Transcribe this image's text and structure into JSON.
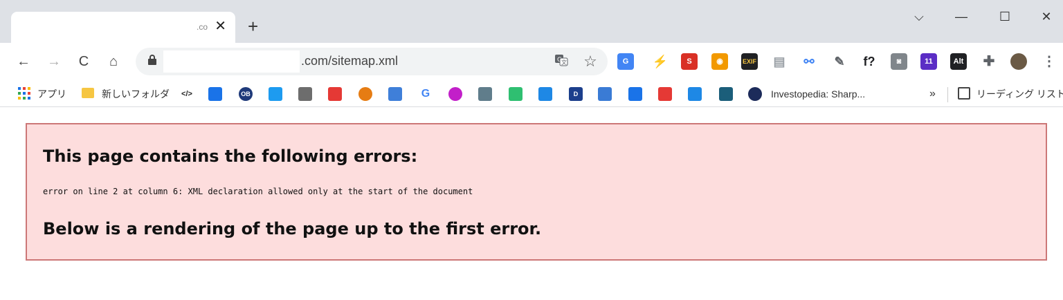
{
  "tab": {
    "title": ".co",
    "close_glyph": "✕"
  },
  "newtab_glyph": "+",
  "window_controls": {
    "tabsearch": "⌵",
    "minimize": "—",
    "maximize": "☐",
    "close": "✕"
  },
  "nav": {
    "back": "←",
    "forward": "→",
    "reload": "C",
    "home": "⌂"
  },
  "address": {
    "url_visible": ".com/sitemap.xml"
  },
  "omnibox_icons": {
    "translate": "translate-icon",
    "star": "☆"
  },
  "extensions": [
    {
      "name": "google-translate-ext-icon",
      "label": "G",
      "color": "#4285f4"
    },
    {
      "name": "bolt-ext-icon",
      "label": "⚡",
      "color": "#9aa0a6"
    },
    {
      "name": "seo-ext-icon",
      "label": "S",
      "color": "#d93025"
    },
    {
      "name": "orange-ext-icon",
      "label": "◉",
      "color": "#f29900"
    },
    {
      "name": "exif-ext-icon",
      "label": "EXIF",
      "color": "#202124"
    },
    {
      "name": "notes-ext-icon",
      "label": "▤",
      "color": "#9aa0a6"
    },
    {
      "name": "link-ext-icon",
      "label": "⚯",
      "color": "#4285f4"
    },
    {
      "name": "eyedropper-ext-icon",
      "label": "✎",
      "color": "#5f6368"
    },
    {
      "name": "font-ext-icon",
      "label": "f?",
      "color": "#202124"
    },
    {
      "name": "camera-ext-icon",
      "label": "◙",
      "color": "#80868b"
    },
    {
      "name": "grad-cap-ext-icon",
      "label": "11",
      "color": "#5b2dc5"
    },
    {
      "name": "alt-ext-icon",
      "label": "Alt",
      "color": "#202124"
    },
    {
      "name": "puzzle-icon",
      "label": "✚",
      "color": "#5f6368"
    },
    {
      "name": "profile-avatar",
      "label": "",
      "color": "#6b5a45"
    },
    {
      "name": "menu-icon",
      "label": "⋮",
      "color": "#5f6368"
    }
  ],
  "bookmarks": {
    "apps_label": "アプリ",
    "folder_label": "新しいフォルダ",
    "investopedia_label": "Investopedia: Sharp...",
    "overflow": "»",
    "reading_list_label": "リーディング リスト",
    "icons": [
      {
        "name": "code-bookmark-icon",
        "color": "#222222",
        "label": "</>"
      },
      {
        "name": "chart-bookmark-icon",
        "color": "#1a73e8",
        "label": ""
      },
      {
        "name": "ob-bookmark-icon",
        "color": "#1f3a7a",
        "label": "OB"
      },
      {
        "name": "twitter-bookmark-icon",
        "color": "#1d9bf0",
        "label": ""
      },
      {
        "name": "landscape-bookmark-icon",
        "color": "#6d6d6d",
        "label": ""
      },
      {
        "name": "flower-bookmark-icon",
        "color": "#e53935",
        "label": ""
      },
      {
        "name": "coin-bookmark-icon",
        "color": "#e67c13",
        "label": ""
      },
      {
        "name": "pixel-bookmark-icon",
        "color": "#3f7fd9",
        "label": ""
      },
      {
        "name": "google-bookmark-icon",
        "color": "#ffffff",
        "label": "G"
      },
      {
        "name": "purple-circle-bookmark-icon",
        "color": "#c21fc9",
        "label": ""
      },
      {
        "name": "robot-bookmark-icon",
        "color": "#607d8b",
        "label": ""
      },
      {
        "name": "bird-bookmark-icon",
        "color": "#2fbf71",
        "label": ""
      },
      {
        "name": "network-bookmark-icon",
        "color": "#1e88e5",
        "label": ""
      },
      {
        "name": "d-bookmark-icon",
        "color": "#1c3f8c",
        "label": "D"
      },
      {
        "name": "trend-bookmark-icon",
        "color": "#3a7bd5",
        "label": ""
      },
      {
        "name": "cloud-bookmark-icon",
        "color": "#1a73e8",
        "label": ""
      },
      {
        "name": "arrow-up-bookmark-icon",
        "color": "#e53935",
        "label": ""
      },
      {
        "name": "bars-bookmark-icon",
        "color": "#1e88e5",
        "label": ""
      },
      {
        "name": "pulse-bookmark-icon",
        "color": "#1b5e7a",
        "label": ""
      },
      {
        "name": "investopedia-bookmark-icon",
        "color": "#1c2b5a",
        "label": ""
      }
    ]
  },
  "error": {
    "heading": "This page contains the following errors:",
    "message": "error on line 2 at column 6: XML declaration allowed only at the start of the document",
    "footer": "Below is a rendering of the page up to the first error."
  }
}
